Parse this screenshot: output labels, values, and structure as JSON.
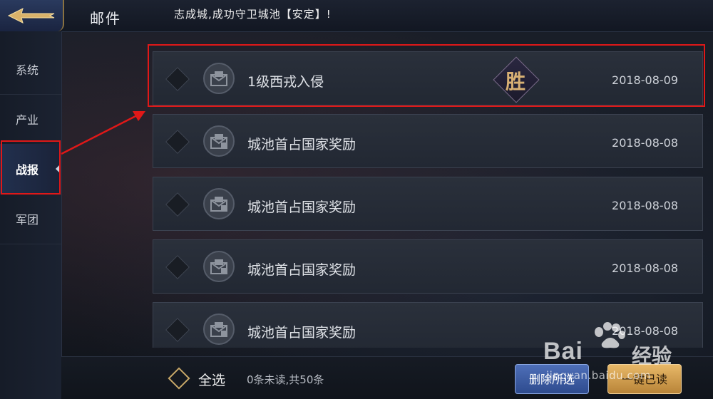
{
  "header": {
    "title": "邮件",
    "ticker": "志成城,成功守卫城池【安定】!"
  },
  "sidebar": {
    "items": [
      {
        "label": "系统",
        "active": false
      },
      {
        "label": "产业",
        "active": false
      },
      {
        "label": "战报",
        "active": true
      },
      {
        "label": "军团",
        "active": false
      }
    ]
  },
  "mails": [
    {
      "subject": "1级西戎入侵",
      "date": "2018-08-09",
      "badge": "胜",
      "icon": "envelope-icon"
    },
    {
      "subject": "城池首占国家奖励",
      "date": "2018-08-08",
      "icon": "envelope-gift-icon"
    },
    {
      "subject": "城池首占国家奖励",
      "date": "2018-08-08",
      "icon": "envelope-gift-icon"
    },
    {
      "subject": "城池首占国家奖励",
      "date": "2018-08-08",
      "icon": "envelope-gift-icon"
    },
    {
      "subject": "城池首占国家奖励",
      "date": "2018-08-08",
      "icon": "envelope-gift-icon"
    }
  ],
  "footer": {
    "select_all_label": "全选",
    "unread_info": "0条未读,共50条",
    "delete_selected_label": "删除所选",
    "mark_all_read_label": "一键已读"
  },
  "watermark": {
    "brand": "Bai",
    "brand_cn": "经验",
    "url": "jingyan.baidu.com"
  },
  "colors": {
    "annotation": "#e01818",
    "accent_gold": "#c8a868",
    "badge_gold": "#d8b074",
    "button_blue": "#2e4b8e",
    "button_gold": "#e8b868"
  }
}
